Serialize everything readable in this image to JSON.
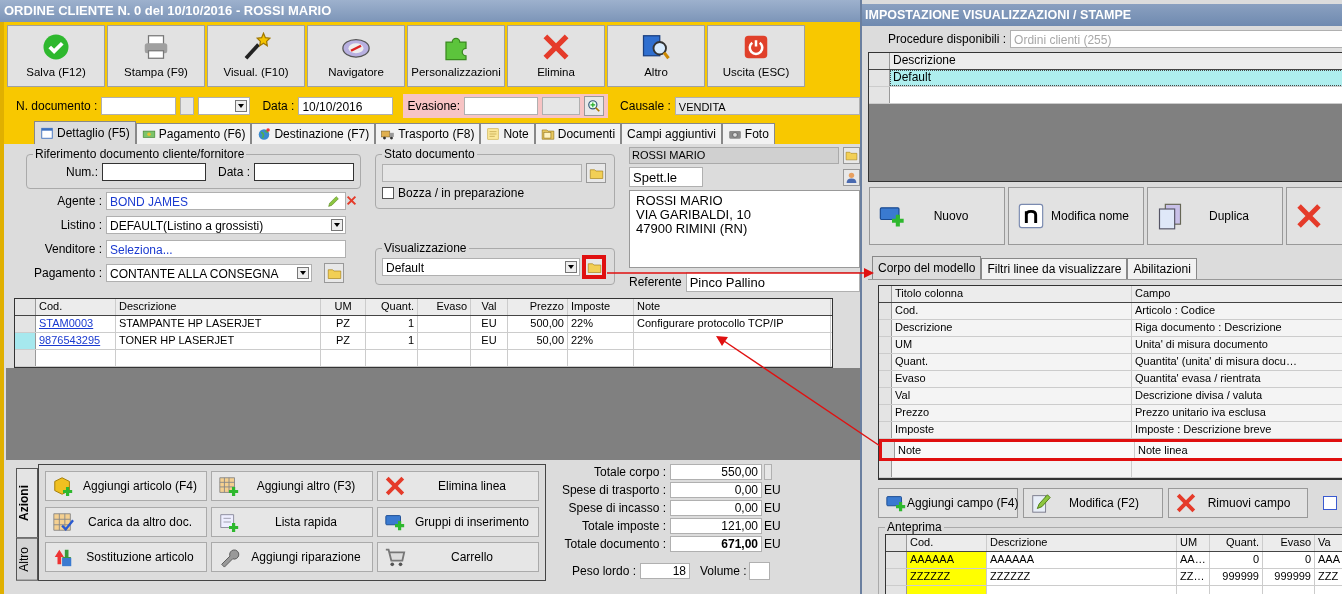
{
  "window": {
    "title": "ORDINE CLIENTE N. 0 del 10/10/2016 - ROSSI MARIO"
  },
  "toolbar": [
    {
      "label": "Salva (F12)",
      "kind": "save"
    },
    {
      "label": "Stampa (F9)",
      "kind": "print"
    },
    {
      "label": "Visual. (F10)",
      "kind": "view"
    },
    {
      "label": "Navigatore",
      "kind": "navigator"
    },
    {
      "label": "Personalizzazioni",
      "kind": "customize"
    },
    {
      "label": "Elimina",
      "kind": "delete"
    },
    {
      "label": "Altro",
      "kind": "other"
    },
    {
      "label": "Uscita (ESC)",
      "kind": "exit"
    }
  ],
  "header": {
    "number_label": "N. documento :",
    "date_label": "Data :",
    "date": "10/10/2016",
    "evasione_label": "Evasione:",
    "causale_label": "Causale :",
    "causale": "VENDITA"
  },
  "tabs": [
    {
      "label": "Dettaglio (F5)",
      "kind": "detail",
      "selected": true
    },
    {
      "label": "Pagamento (F6)",
      "kind": "payment",
      "selected": false
    },
    {
      "label": "Destinazione (F7)",
      "kind": "destination",
      "selected": false
    },
    {
      "label": "Trasporto (F8)",
      "kind": "transport",
      "selected": false
    },
    {
      "label": "Note",
      "kind": "notes",
      "selected": false
    },
    {
      "label": "Documenti",
      "kind": "documents",
      "selected": false
    },
    {
      "label": "Campi aggiuntivi",
      "kind": "plain",
      "selected": false
    },
    {
      "label": "Foto",
      "kind": "photo",
      "selected": false
    }
  ],
  "reference": {
    "title": "Riferimento documento cliente/fornitore",
    "number_label": "Num.:",
    "date_label": "Data :"
  },
  "fields": [
    {
      "label": "Agente :",
      "value": "BOND JAMES",
      "kind": "agent"
    },
    {
      "label": "Listino :",
      "value": "DEFAULT(Listino a grossisti)",
      "kind": "select"
    },
    {
      "label": "Venditore :",
      "value": "Seleziona...",
      "kind": "link"
    },
    {
      "label": "Pagamento :",
      "value": "CONTANTE ALLA CONSEGNA",
      "kind": "select_folder"
    }
  ],
  "status": {
    "title": "Stato documento",
    "draft_label": "Bozza / in preparazione",
    "draft": false
  },
  "view": {
    "title": "Visualizzazione",
    "value": "Default",
    "highlighted": true
  },
  "customer": {
    "name": "ROSSI MARIO",
    "salutation": "Spett.le",
    "address": [
      "ROSSI MARIO",
      "VIA GARIBALDI, 10",
      "47900 RIMINI (RN)"
    ],
    "contact_label": "Referente",
    "contact": "Pinco Pallino"
  },
  "table": {
    "columns": [
      "Cod.",
      "Descrizione",
      "UM",
      "Quant.",
      "Evaso",
      "Val",
      "Prezzo",
      "Imposte",
      "Note"
    ],
    "rows": [
      {
        "cells": [
          "STAM0003",
          "STAMPANTE HP LASERJET",
          "PZ",
          "1",
          "",
          "EU",
          "500,00",
          "22%",
          "Configurare protocollo TCP/IP"
        ],
        "selected": false
      },
      {
        "cells": [
          "9876543295",
          "TONER HP LASERJET",
          "PZ",
          "1",
          "",
          "EU",
          "50,00",
          "22%",
          ""
        ],
        "selected": true
      }
    ]
  },
  "actions": {
    "tabs": [
      {
        "label": "Azioni",
        "selected": true
      },
      {
        "label": "Altro",
        "selected": false
      }
    ],
    "buttons": [
      {
        "label": "Aggiungi articolo (F4)",
        "kind": "add_item"
      },
      {
        "label": "Aggiungi altro (F3)",
        "kind": "add_other"
      },
      {
        "label": "Elimina linea",
        "kind": "delete_line"
      },
      {
        "label": "Carica da altro doc.",
        "kind": "load"
      },
      {
        "label": "Lista rapida",
        "kind": "quick_list"
      },
      {
        "label": "Gruppi di inserimento",
        "kind": "groups"
      },
      {
        "label": "Sostituzione articolo",
        "kind": "replace"
      },
      {
        "label": "Aggiungi riparazione",
        "kind": "repair"
      },
      {
        "label": "Carrello",
        "kind": "cart"
      }
    ]
  },
  "totals": [
    {
      "label": "Totale corpo :",
      "value": "550,00",
      "bold": false
    },
    {
      "label": "Spese di trasporto :",
      "value": "0,00",
      "unit": "EU",
      "bold": false
    },
    {
      "label": "Spese di incasso :",
      "value": "0,00",
      "unit": "EU",
      "bold": false
    },
    {
      "label": "Totale imposte :",
      "value": "121,00",
      "unit": "EU",
      "bold": false
    },
    {
      "label": "Totale documento :",
      "value": "671,00",
      "unit": "EU",
      "bold": true
    }
  ],
  "weight": {
    "label": "Peso lordo :",
    "value": "18",
    "volume_label": "Volume :"
  },
  "dialog": {
    "title": "IMPOSTAZIONE VISUALIZZAZIONI / STAMPE",
    "procedure_label": "Procedure disponibili :",
    "procedure": "Ordini clienti (255)",
    "list": {
      "column": "Descrizione",
      "rows": [
        {
          "label": "Default",
          "selected": true
        }
      ]
    },
    "buttons": [
      {
        "label": "Nuovo",
        "kind": "new"
      },
      {
        "label": "Modifica nome",
        "kind": "rename"
      },
      {
        "label": "Duplica",
        "kind": "duplicate"
      },
      {
        "kind": "delete"
      }
    ],
    "tabs": [
      {
        "label": "Corpo del modello",
        "selected": true
      },
      {
        "label": "Filtri linee da visualizzare",
        "selected": false
      },
      {
        "label": "Abilitazioni",
        "selected": false
      }
    ],
    "columns": {
      "columns": [
        "Titolo colonna",
        "Campo"
      ],
      "rows": [
        {
          "title": "Cod.",
          "field": "Articolo : Codice",
          "highlighted": false
        },
        {
          "title": "Descrizione",
          "field": "Riga documento : Descrizione",
          "highlighted": false
        },
        {
          "title": "UM",
          "field": "Unita' di misura documento",
          "highlighted": false
        },
        {
          "title": "Quant.",
          "field": "Quantita' (unita' di misura docu…",
          "highlighted": false
        },
        {
          "title": "Evaso",
          "field": "Quantita' evasa / rientrata",
          "highlighted": false
        },
        {
          "title": "Val",
          "field": "Descrizione divisa / valuta",
          "highlighted": false
        },
        {
          "title": "Prezzo",
          "field": "Prezzo unitario iva esclusa",
          "highlighted": false
        },
        {
          "title": "Imposte",
          "field": "Imposte : Descrizione breve",
          "highlighted": false
        },
        {
          "title": "Note",
          "field": "Note linea",
          "highlighted": true
        }
      ]
    },
    "field_buttons": [
      {
        "label": "Aggiungi campo (F4)",
        "kind": "add"
      },
      {
        "label": "Modifica (F2)",
        "kind": "edit"
      },
      {
        "label": "Rimuovi campo",
        "kind": "remove"
      }
    ],
    "option": {
      "checked": false
    },
    "preview": {
      "title": "Anteprima",
      "columns": [
        "Cod.",
        "Descrizione",
        "UM",
        "Quant.",
        "Evaso",
        "Va"
      ],
      "rows": [
        [
          "AAAAAA",
          "AAAAAA",
          "AA…",
          "0",
          "0",
          "AAA"
        ],
        [
          "ZZZZZZ",
          "ZZZZZZ",
          "ZZ…",
          "999999",
          "999999",
          "ZZZ"
        ]
      ]
    }
  }
}
